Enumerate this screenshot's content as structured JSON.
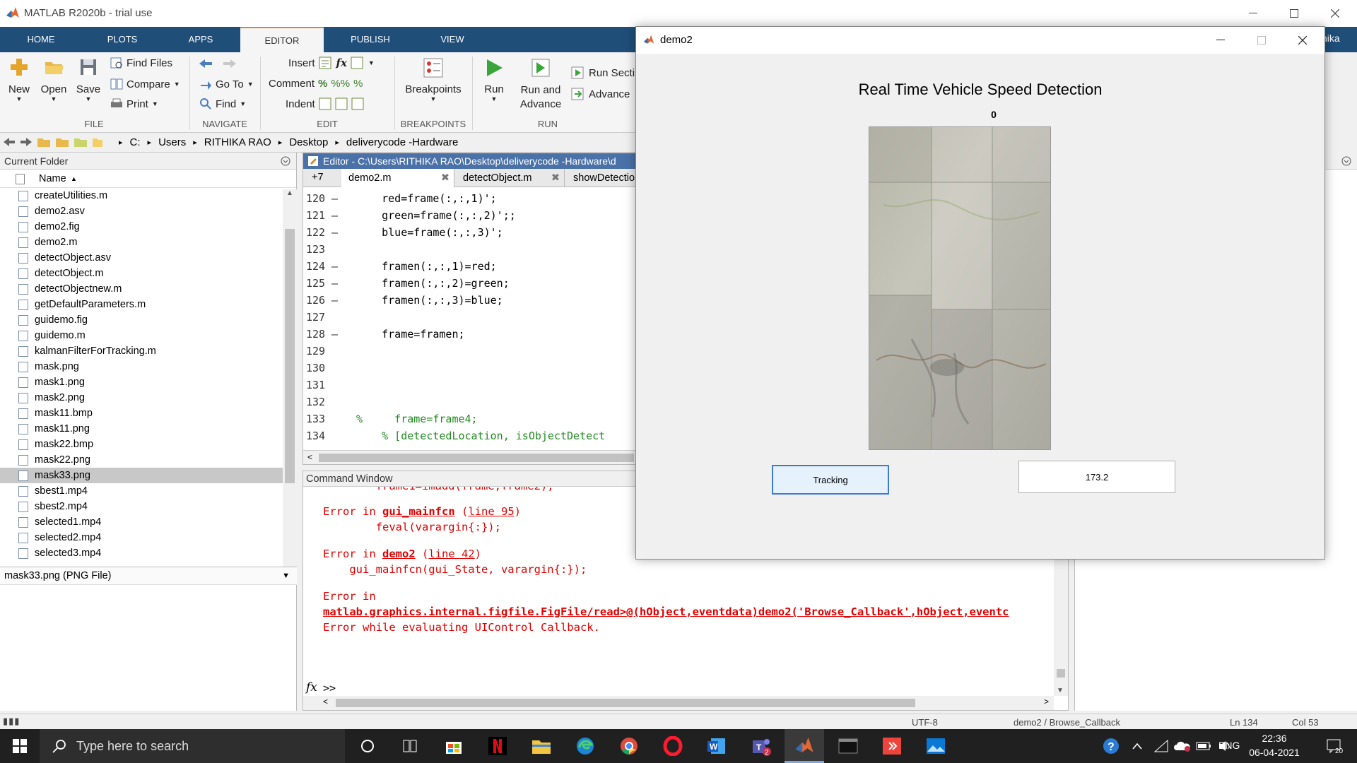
{
  "app": {
    "title": "MATLAB R2020b - trial use"
  },
  "tabs": [
    "HOME",
    "PLOTS",
    "APPS",
    "EDITOR",
    "PUBLISH",
    "VIEW"
  ],
  "toolstrip": {
    "new": "New",
    "open": "Open",
    "save": "Save",
    "find_files": "Find Files",
    "compare": "Compare",
    "print": "Print",
    "go_to": "Go To",
    "find": "Find",
    "insert": "Insert",
    "comment": "Comment",
    "indent": "Indent",
    "breakpoints": "Breakpoints",
    "run": "Run",
    "run_and_advance_1": "Run and",
    "run_and_advance_2": "Advance",
    "run_section": "Run Secti",
    "advance": "Advance",
    "groups": {
      "file": "FILE",
      "navigate": "NAVIGATE",
      "edit": "EDIT",
      "breakpoints": "BREAKPOINTS",
      "run": "RUN"
    },
    "user_fragment": "hika"
  },
  "address": {
    "crumbs": [
      "C:",
      "Users",
      "RITHIKA RAO",
      "Desktop",
      "deliverycode -Hardware"
    ]
  },
  "current_folder": {
    "title": "Current Folder",
    "column": "Name",
    "files": [
      "createUtilities.m",
      "demo2.asv",
      "demo2.fig",
      "demo2.m",
      "detectObject.asv",
      "detectObject.m",
      "detectObjectnew.m",
      "getDefaultParameters.m",
      "guidemo.fig",
      "guidemo.m",
      "kalmanFilterForTracking.m",
      "mask.png",
      "mask1.png",
      "mask2.png",
      "mask11.bmp",
      "mask11.png",
      "mask22.bmp",
      "mask22.png",
      "mask33.png",
      "sbest1.mp4",
      "sbest2.mp4",
      "selected1.mp4",
      "selected2.mp4",
      "selected3.mp4"
    ],
    "selected_index": 18,
    "details": "mask33.png  (PNG File)"
  },
  "editor": {
    "title": "Editor - C:\\Users\\RITHIKA RAO\\Desktop\\deliverycode -Hardware\\d",
    "more_tabs": "+7",
    "tabs": [
      "demo2.m",
      "detectObject.m",
      "showDetections.m"
    ],
    "lines": [
      {
        "n": "120",
        "d": "–",
        "code": "    red=frame(:,:,1)';"
      },
      {
        "n": "121",
        "d": "–",
        "code": "    green=frame(:,:,2)';;"
      },
      {
        "n": "122",
        "d": "–",
        "code": "    blue=frame(:,:,3)';"
      },
      {
        "n": "123",
        "d": "",
        "code": ""
      },
      {
        "n": "124",
        "d": "–",
        "code": "    framen(:,:,1)=red;"
      },
      {
        "n": "125",
        "d": "–",
        "code": "    framen(:,:,2)=green;"
      },
      {
        "n": "126",
        "d": "–",
        "code": "    framen(:,:,3)=blue;"
      },
      {
        "n": "127",
        "d": "",
        "code": ""
      },
      {
        "n": "128",
        "d": "–",
        "code": "    frame=framen;"
      },
      {
        "n": "129",
        "d": "",
        "code": ""
      },
      {
        "n": "130",
        "d": "",
        "code": ""
      },
      {
        "n": "131",
        "d": "",
        "code": ""
      },
      {
        "n": "132",
        "d": "",
        "code": ""
      },
      {
        "n": "133",
        "d": "",
        "code": "%     frame=frame4;"
      },
      {
        "n": "134",
        "d": "",
        "code": "    % [detectedLocation, isObjectDetect"
      }
    ]
  },
  "command_window": {
    "title": "Command Window",
    "partial_line": "        frame1=imadd(frame,frame2);",
    "error_in": "Error in",
    "err1_fn": "gui_mainfcn",
    "err1_line": "line 95",
    "err1_code": "        feval(varargin{:});",
    "err2_fn": "demo2",
    "err2_line": "line 42",
    "err2_code": "    gui_mainfcn(gui_State, varargin{:});",
    "err3_link": "matlab.graphics.internal.figfile.FigFile/read>@(hObject,eventdata)demo2('Browse_Callback',hObject,eventc",
    "err_final": "Error while evaluating UIControl Callback.",
    "fx": "fx",
    "prompt": ">>"
  },
  "statusbar": {
    "encoding": "UTF-8",
    "context": "demo2 / Browse_Callback",
    "ln": "Ln  134",
    "col": "Col  53"
  },
  "demo2": {
    "window_title": "demo2",
    "heading": "Real Time Vehicle Speed Detection",
    "axes_label": "0",
    "button": "Tracking",
    "speed_value": "173.2"
  },
  "taskbar": {
    "search_placeholder": "Type here to search",
    "lang": "ENG",
    "time": "22:36",
    "date": "06-04-2021",
    "notifications": "20",
    "teams_badge": "2"
  },
  "colors": {
    "matlab_tab_blue": "#1f4e79",
    "error_red": "#e00000",
    "taskbar": "#202020"
  }
}
